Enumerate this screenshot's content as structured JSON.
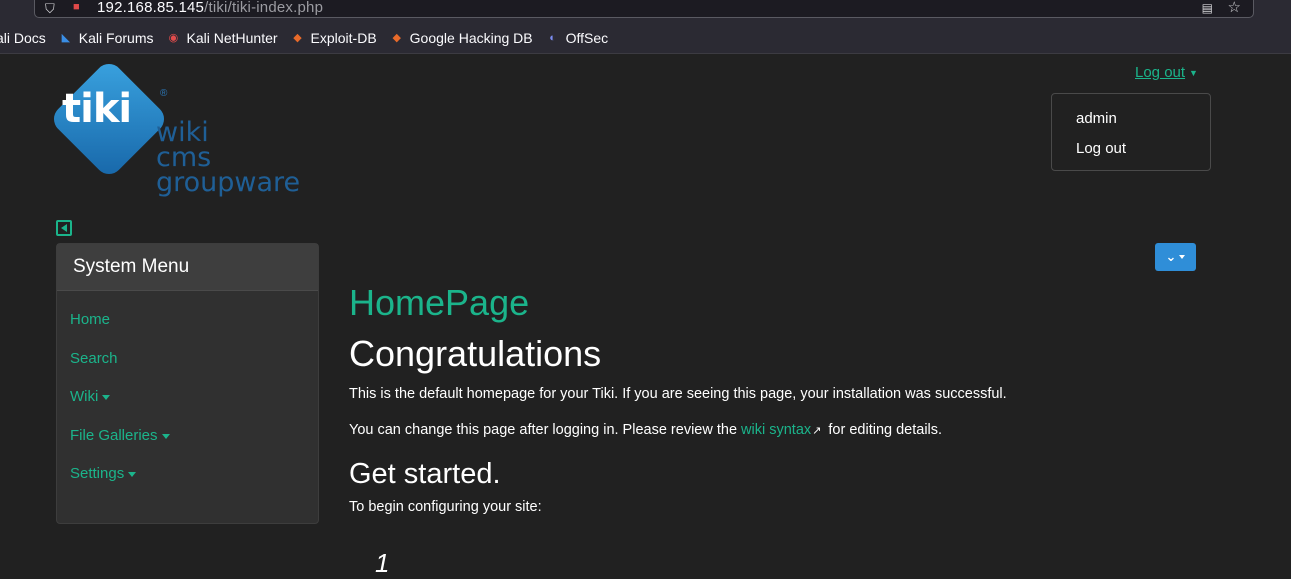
{
  "browser": {
    "url_host": "192.168.85.145",
    "url_path": "/tiki/tiki-index.php",
    "bookmarks": [
      {
        "label": "ali Docs",
        "icon": "kali-docs-icon"
      },
      {
        "label": "Kali Forums",
        "icon": "kali-forums-icon"
      },
      {
        "label": "Kali NetHunter",
        "icon": "kali-nethunter-icon"
      },
      {
        "label": "Exploit-DB",
        "icon": "exploit-db-icon"
      },
      {
        "label": "Google Hacking DB",
        "icon": "ghdb-icon"
      },
      {
        "label": "OffSec",
        "icon": "offsec-icon"
      }
    ]
  },
  "logo": {
    "mark": "tiki",
    "reg": "®",
    "words": [
      "wiki",
      "cms",
      "groupware"
    ],
    "colors": {
      "diamond": "#2a86cc",
      "words": "#1f5f96"
    }
  },
  "user_menu": {
    "toggle_label": "Log out",
    "items": [
      "admin",
      "Log out"
    ]
  },
  "system_menu": {
    "title": "System Menu",
    "items": [
      {
        "label": "Home",
        "dropdown": false
      },
      {
        "label": "Search",
        "dropdown": false
      },
      {
        "label": "Wiki",
        "dropdown": true
      },
      {
        "label": "File Galleries",
        "dropdown": true
      },
      {
        "label": "Settings",
        "dropdown": true
      }
    ]
  },
  "page": {
    "page_title": "HomePage",
    "heading": "Congratulations",
    "intro": "This is the default homepage for your Tiki. If you are seeing this page, your installation was successful.",
    "change_before": "You can change this page after logging in. Please review the ",
    "change_link": "wiki syntax",
    "change_after": " for editing details.",
    "subheading": "Get started.",
    "configure": "To begin configuring your site:",
    "list_number": "1"
  },
  "colors": {
    "accent": "#1bb48b",
    "background": "#212121",
    "button": "#2f8ed8"
  }
}
